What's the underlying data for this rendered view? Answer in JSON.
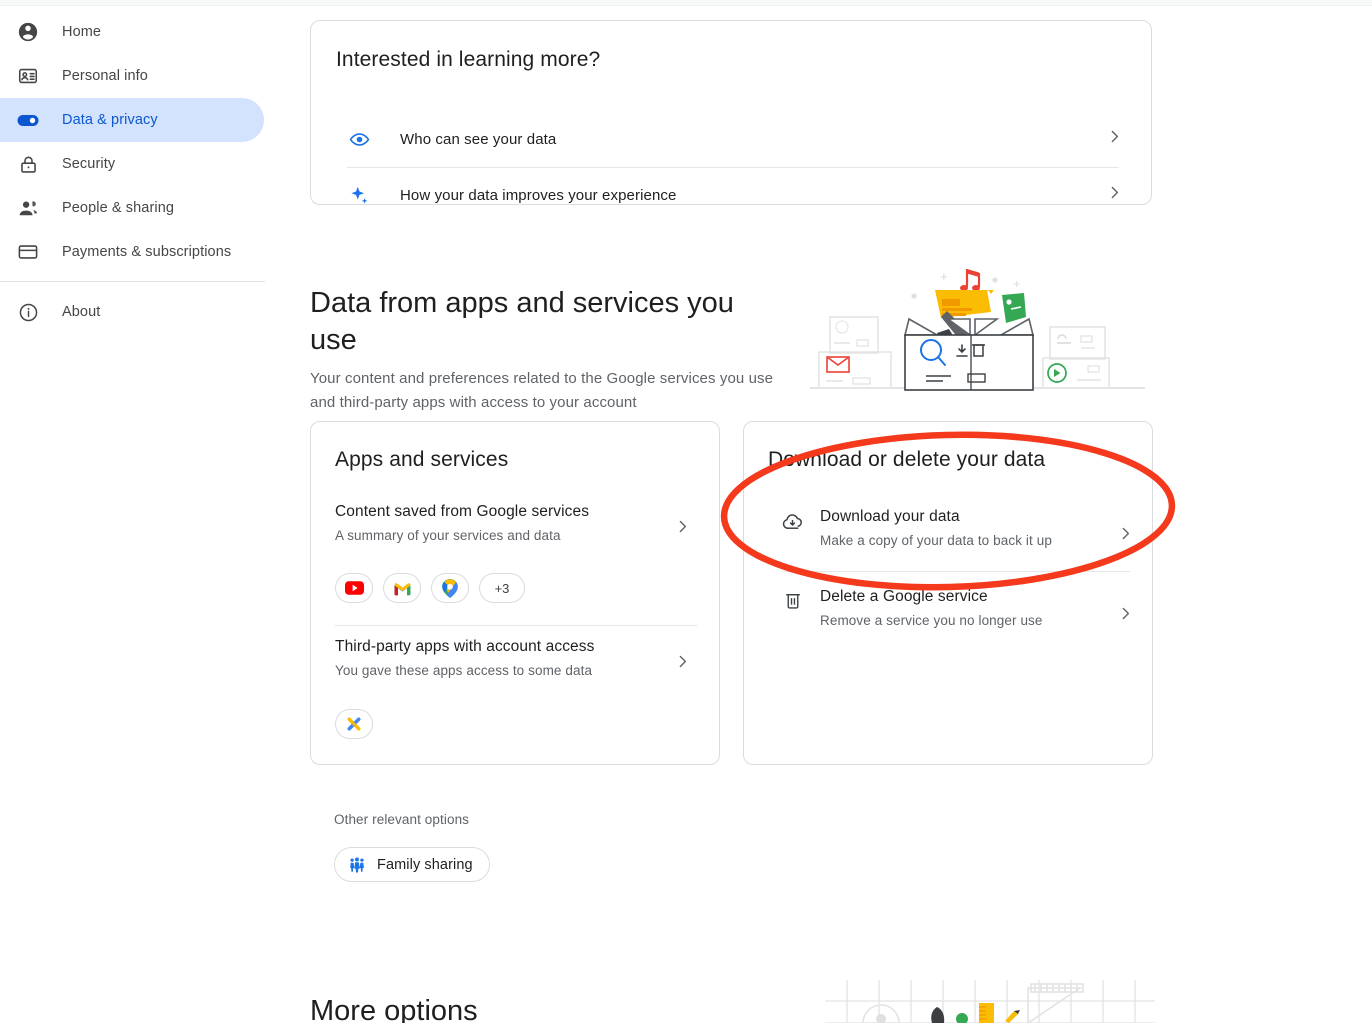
{
  "sidebar": {
    "items": [
      {
        "label": "Home",
        "icon": "account-circle-icon",
        "active": false
      },
      {
        "label": "Personal info",
        "icon": "badge-icon",
        "active": false
      },
      {
        "label": "Data & privacy",
        "icon": "toggle-on-icon",
        "active": true
      },
      {
        "label": "Security",
        "icon": "lock-icon",
        "active": false
      },
      {
        "label": "People & sharing",
        "icon": "people-icon",
        "active": false
      },
      {
        "label": "Payments & subscriptions",
        "icon": "credit-card-icon",
        "active": false
      },
      {
        "label": "About",
        "icon": "info-icon",
        "active": false
      }
    ]
  },
  "learn_more_card": {
    "title": "Interested in learning more?",
    "rows": [
      {
        "label": "Who can see your data",
        "icon": "eye-icon"
      },
      {
        "label": "How your data improves your experience",
        "icon": "sparkle-icon"
      }
    ]
  },
  "data_section": {
    "title": "Data from apps and services you use",
    "subtitle": "Your content and preferences related to the Google services you use and third-party apps with access to your account"
  },
  "apps_card": {
    "title": "Apps and services",
    "rows": [
      {
        "title": "Content saved from Google services",
        "subtitle": "A summary of your services and data",
        "chips": [
          "youtube-icon",
          "gmail-icon",
          "maps-icon",
          "+3"
        ]
      },
      {
        "title": "Third-party apps with account access",
        "subtitle": "You gave these apps access to some data",
        "chips": [
          "third-party-app-icon"
        ]
      }
    ]
  },
  "download_card": {
    "title": "Download or delete your data",
    "rows": [
      {
        "title": "Download your data",
        "subtitle": "Make a copy of your data to back it up",
        "icon": "cloud-download-icon"
      },
      {
        "title": "Delete a Google service",
        "subtitle": "Remove a service you no longer use",
        "icon": "trash-icon"
      }
    ]
  },
  "other_options": {
    "label": "Other relevant options",
    "chip_label": "Family sharing",
    "chip_icon": "family-icon"
  },
  "more_options": {
    "title": "More options"
  },
  "annotation": {
    "shape": "ellipse",
    "color": "#f4391c",
    "target": "Download your data"
  },
  "colors": {
    "accent_blue": "#0b57d0",
    "active_pill": "#d3e3fd",
    "text_primary": "#1f1f1f",
    "text_secondary": "#5f6368",
    "card_border": "#dadce0",
    "annotation_red": "#f4391c"
  }
}
